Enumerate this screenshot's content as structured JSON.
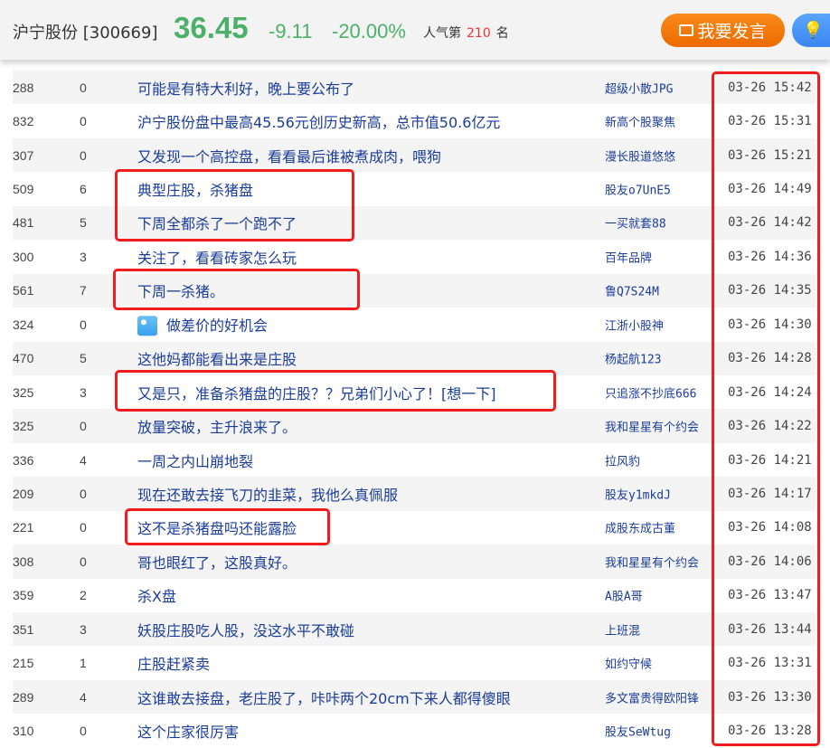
{
  "header": {
    "stock_name": "沪宁股份 [300669]",
    "price": "36.45",
    "change": "-9.11",
    "change_pct": "-20.00%",
    "rank_prefix": "人气第",
    "rank": "210",
    "rank_suffix": "名",
    "post_button": "我要发言",
    "blue_button_icon": "lightbulb-icon",
    "colors": {
      "down": "#4caf6a",
      "post": "#f07400",
      "rank": "#e33"
    }
  },
  "posts": [
    {
      "read": "288",
      "comments": "0",
      "title": "可能是有特大利好，晚上要公布了",
      "author": "超级小散JPG",
      "time": "03-26 15:42"
    },
    {
      "read": "832",
      "comments": "0",
      "title": "沪宁股份盘中最高45.56元创历史新高，总市值50.6亿元",
      "author": "新高个股聚焦",
      "time": "03-26 15:31"
    },
    {
      "read": "307",
      "comments": "0",
      "title": "又发现一个高控盘，看看最后谁被煮成肉，喂狗",
      "author": "漫长股道悠悠",
      "time": "03-26 15:21"
    },
    {
      "read": "509",
      "comments": "6",
      "title": "典型庄股，杀猪盘",
      "author": "股友o7UnE5",
      "time": "03-26 14:49"
    },
    {
      "read": "481",
      "comments": "5",
      "title": "下周全都杀了一个跑不了",
      "author": "一买就套88",
      "time": "03-26 14:42"
    },
    {
      "read": "300",
      "comments": "3",
      "title": "关注了，看看砖家怎么玩",
      "author": "百年品牌",
      "time": "03-26 14:36"
    },
    {
      "read": "561",
      "comments": "7",
      "title": "下周一杀猪。",
      "author": "鲁Q7S24M",
      "time": "03-26 14:35"
    },
    {
      "read": "324",
      "comments": "0",
      "title": "做差价的好机会",
      "author": "江浙小股神",
      "time": "03-26 14:30",
      "has_image": true
    },
    {
      "read": "470",
      "comments": "5",
      "title": "这他妈都能看出来是庄股",
      "author": "杨起航123",
      "time": "03-26 14:28"
    },
    {
      "read": "325",
      "comments": "3",
      "title": "又是只，准备杀猪盘的庄股？？兄弟们小心了！[想一下]",
      "author": "只追涨不抄底666",
      "time": "03-26 14:24"
    },
    {
      "read": "325",
      "comments": "0",
      "title": "放量突破，主升浪来了。",
      "author": "我和星星有个约会",
      "time": "03-26 14:22"
    },
    {
      "read": "336",
      "comments": "4",
      "title": "一周之内山崩地裂",
      "author": "拉风豹",
      "time": "03-26 14:21"
    },
    {
      "read": "209",
      "comments": "0",
      "title": "现在还敢去接飞刀的韭菜，我他么真佩服",
      "author": "股友y1mkdJ",
      "time": "03-26 14:17"
    },
    {
      "read": "221",
      "comments": "0",
      "title": "这不是杀猪盘吗还能露脸",
      "author": "成股东成古董",
      "time": "03-26 14:08"
    },
    {
      "read": "308",
      "comments": "0",
      "title": "哥也眼红了，这股真好。",
      "author": "我和星星有个约会",
      "time": "03-26 14:06"
    },
    {
      "read": "359",
      "comments": "2",
      "title": "杀X盘",
      "author": "A股A哥",
      "time": "03-26 13:47"
    },
    {
      "read": "351",
      "comments": "3",
      "title": "妖股庄股吃人股，没这水平不敢碰",
      "author": "上班混",
      "time": "03-26 13:44"
    },
    {
      "read": "215",
      "comments": "1",
      "title": "庄股赶紧卖",
      "author": "如约守候",
      "time": "03-26 13:31"
    },
    {
      "read": "289",
      "comments": "4",
      "title": "这谁敢去接盘，老庄股了，咔咔两个20cm下来人都得傻眼",
      "author": "多文富贵得欧阳锋",
      "time": "03-26 13:30"
    },
    {
      "read": "310",
      "comments": "0",
      "title": "这个庄家很厉害",
      "author": "股友SeWtug",
      "time": "03-26 13:28"
    }
  ]
}
